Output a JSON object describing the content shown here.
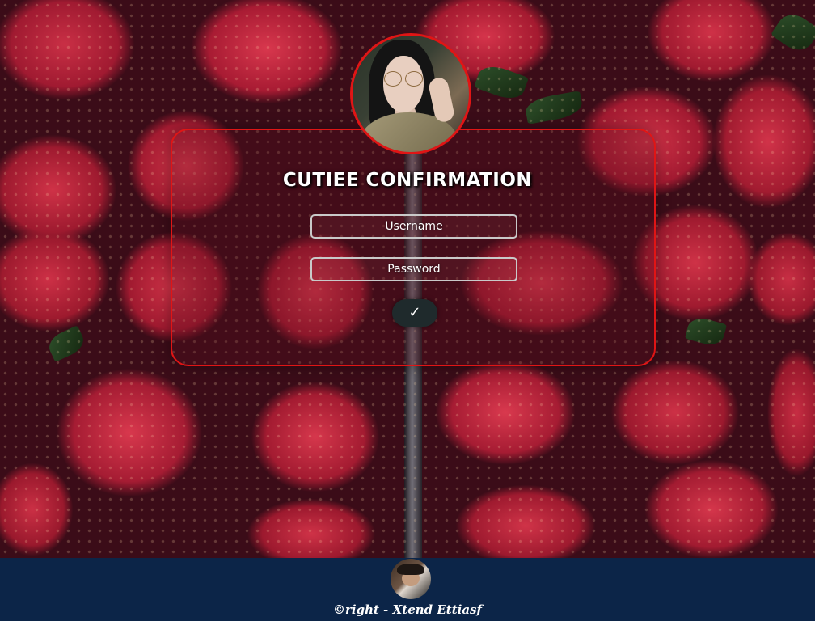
{
  "form": {
    "title": "CUTIEE CONFIRMATION",
    "username_placeholder": "Username",
    "password_placeholder": "Password",
    "submit_label": "✓"
  },
  "footer": {
    "credit": "©right - Xtend Ettiasf"
  },
  "colors": {
    "accent_border": "#e01515",
    "footer_bg": "#0c2548",
    "submit_bg": "#1f2a2c"
  },
  "icons": {
    "profile": "profile-photo",
    "footer_avatar": "author-avatar",
    "submit": "check-icon"
  }
}
